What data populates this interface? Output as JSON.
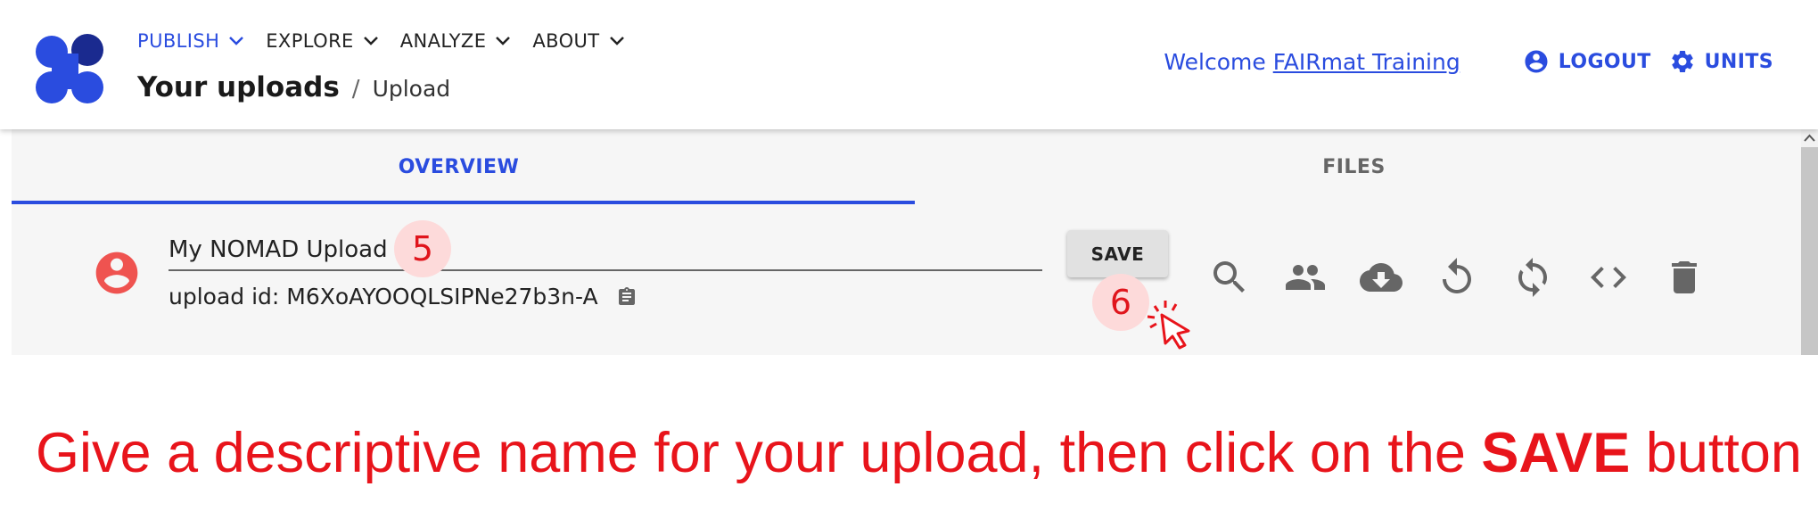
{
  "nav": {
    "menu": [
      {
        "label": "PUBLISH",
        "active": true
      },
      {
        "label": "EXPLORE",
        "active": false
      },
      {
        "label": "ANALYZE",
        "active": false
      },
      {
        "label": "ABOUT",
        "active": false
      }
    ],
    "breadcrumb": {
      "main": "Your uploads",
      "separator": "/",
      "current": "Upload"
    },
    "welcome_prefix": "Welcome",
    "user_name": "FAIRmat Training",
    "logout_label": "LOGOUT",
    "units_label": "UNITS"
  },
  "tabs": [
    {
      "label": "OVERVIEW",
      "active": true
    },
    {
      "label": "FILES",
      "active": false
    }
  ],
  "upload": {
    "name": "My NOMAD Upload",
    "id_label": "upload id: M6XoAYOOQLSIPNe27b3n-A",
    "save_label": "SAVE"
  },
  "actions": [
    {
      "icon": "search-icon"
    },
    {
      "icon": "group-icon"
    },
    {
      "icon": "cloud-download-icon"
    },
    {
      "icon": "undo-icon"
    },
    {
      "icon": "sync-icon"
    },
    {
      "icon": "code-icon"
    },
    {
      "icon": "delete-icon"
    }
  ],
  "annotations": {
    "step5": "5",
    "step6": "6",
    "instruction_prefix": "Give a descriptive name for your upload, then click on the",
    "instruction_bold": "SAVE",
    "instruction_suffix": "button"
  },
  "colors": {
    "accent": "#2a4cdf",
    "annotation_red": "#e8141b",
    "avatar_red": "#ef5350",
    "logo_light": "#2a4cdf",
    "logo_dark": "#1a2a8f"
  }
}
